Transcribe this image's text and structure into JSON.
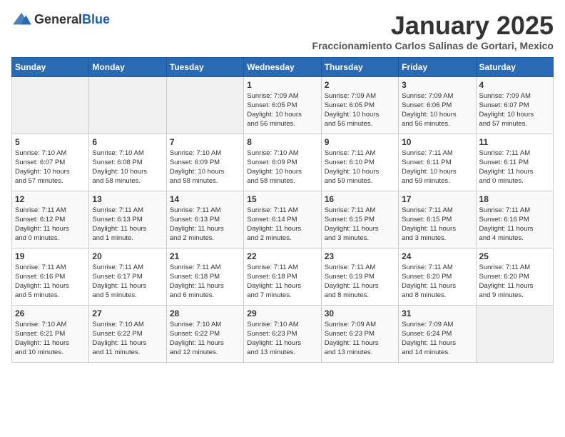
{
  "header": {
    "logo_general": "General",
    "logo_blue": "Blue",
    "month_title": "January 2025",
    "location": "Fraccionamiento Carlos Salinas de Gortari, Mexico"
  },
  "weekdays": [
    "Sunday",
    "Monday",
    "Tuesday",
    "Wednesday",
    "Thursday",
    "Friday",
    "Saturday"
  ],
  "weeks": [
    [
      {
        "day": "",
        "info": ""
      },
      {
        "day": "",
        "info": ""
      },
      {
        "day": "",
        "info": ""
      },
      {
        "day": "1",
        "info": "Sunrise: 7:09 AM\nSunset: 6:05 PM\nDaylight: 10 hours\nand 56 minutes."
      },
      {
        "day": "2",
        "info": "Sunrise: 7:09 AM\nSunset: 6:05 PM\nDaylight: 10 hours\nand 56 minutes."
      },
      {
        "day": "3",
        "info": "Sunrise: 7:09 AM\nSunset: 6:06 PM\nDaylight: 10 hours\nand 56 minutes."
      },
      {
        "day": "4",
        "info": "Sunrise: 7:09 AM\nSunset: 6:07 PM\nDaylight: 10 hours\nand 57 minutes."
      }
    ],
    [
      {
        "day": "5",
        "info": "Sunrise: 7:10 AM\nSunset: 6:07 PM\nDaylight: 10 hours\nand 57 minutes."
      },
      {
        "day": "6",
        "info": "Sunrise: 7:10 AM\nSunset: 6:08 PM\nDaylight: 10 hours\nand 58 minutes."
      },
      {
        "day": "7",
        "info": "Sunrise: 7:10 AM\nSunset: 6:09 PM\nDaylight: 10 hours\nand 58 minutes."
      },
      {
        "day": "8",
        "info": "Sunrise: 7:10 AM\nSunset: 6:09 PM\nDaylight: 10 hours\nand 58 minutes."
      },
      {
        "day": "9",
        "info": "Sunrise: 7:11 AM\nSunset: 6:10 PM\nDaylight: 10 hours\nand 59 minutes."
      },
      {
        "day": "10",
        "info": "Sunrise: 7:11 AM\nSunset: 6:11 PM\nDaylight: 10 hours\nand 59 minutes."
      },
      {
        "day": "11",
        "info": "Sunrise: 7:11 AM\nSunset: 6:11 PM\nDaylight: 11 hours\nand 0 minutes."
      }
    ],
    [
      {
        "day": "12",
        "info": "Sunrise: 7:11 AM\nSunset: 6:12 PM\nDaylight: 11 hours\nand 0 minutes."
      },
      {
        "day": "13",
        "info": "Sunrise: 7:11 AM\nSunset: 6:13 PM\nDaylight: 11 hours\nand 1 minute."
      },
      {
        "day": "14",
        "info": "Sunrise: 7:11 AM\nSunset: 6:13 PM\nDaylight: 11 hours\nand 2 minutes."
      },
      {
        "day": "15",
        "info": "Sunrise: 7:11 AM\nSunset: 6:14 PM\nDaylight: 11 hours\nand 2 minutes."
      },
      {
        "day": "16",
        "info": "Sunrise: 7:11 AM\nSunset: 6:15 PM\nDaylight: 11 hours\nand 3 minutes."
      },
      {
        "day": "17",
        "info": "Sunrise: 7:11 AM\nSunset: 6:15 PM\nDaylight: 11 hours\nand 3 minutes."
      },
      {
        "day": "18",
        "info": "Sunrise: 7:11 AM\nSunset: 6:16 PM\nDaylight: 11 hours\nand 4 minutes."
      }
    ],
    [
      {
        "day": "19",
        "info": "Sunrise: 7:11 AM\nSunset: 6:16 PM\nDaylight: 11 hours\nand 5 minutes."
      },
      {
        "day": "20",
        "info": "Sunrise: 7:11 AM\nSunset: 6:17 PM\nDaylight: 11 hours\nand 5 minutes."
      },
      {
        "day": "21",
        "info": "Sunrise: 7:11 AM\nSunset: 6:18 PM\nDaylight: 11 hours\nand 6 minutes."
      },
      {
        "day": "22",
        "info": "Sunrise: 7:11 AM\nSunset: 6:18 PM\nDaylight: 11 hours\nand 7 minutes."
      },
      {
        "day": "23",
        "info": "Sunrise: 7:11 AM\nSunset: 6:19 PM\nDaylight: 11 hours\nand 8 minutes."
      },
      {
        "day": "24",
        "info": "Sunrise: 7:11 AM\nSunset: 6:20 PM\nDaylight: 11 hours\nand 8 minutes."
      },
      {
        "day": "25",
        "info": "Sunrise: 7:11 AM\nSunset: 6:20 PM\nDaylight: 11 hours\nand 9 minutes."
      }
    ],
    [
      {
        "day": "26",
        "info": "Sunrise: 7:10 AM\nSunset: 6:21 PM\nDaylight: 11 hours\nand 10 minutes."
      },
      {
        "day": "27",
        "info": "Sunrise: 7:10 AM\nSunset: 6:22 PM\nDaylight: 11 hours\nand 11 minutes."
      },
      {
        "day": "28",
        "info": "Sunrise: 7:10 AM\nSunset: 6:22 PM\nDaylight: 11 hours\nand 12 minutes."
      },
      {
        "day": "29",
        "info": "Sunrise: 7:10 AM\nSunset: 6:23 PM\nDaylight: 11 hours\nand 13 minutes."
      },
      {
        "day": "30",
        "info": "Sunrise: 7:09 AM\nSunset: 6:23 PM\nDaylight: 11 hours\nand 13 minutes."
      },
      {
        "day": "31",
        "info": "Sunrise: 7:09 AM\nSunset: 6:24 PM\nDaylight: 11 hours\nand 14 minutes."
      },
      {
        "day": "",
        "info": ""
      }
    ]
  ]
}
